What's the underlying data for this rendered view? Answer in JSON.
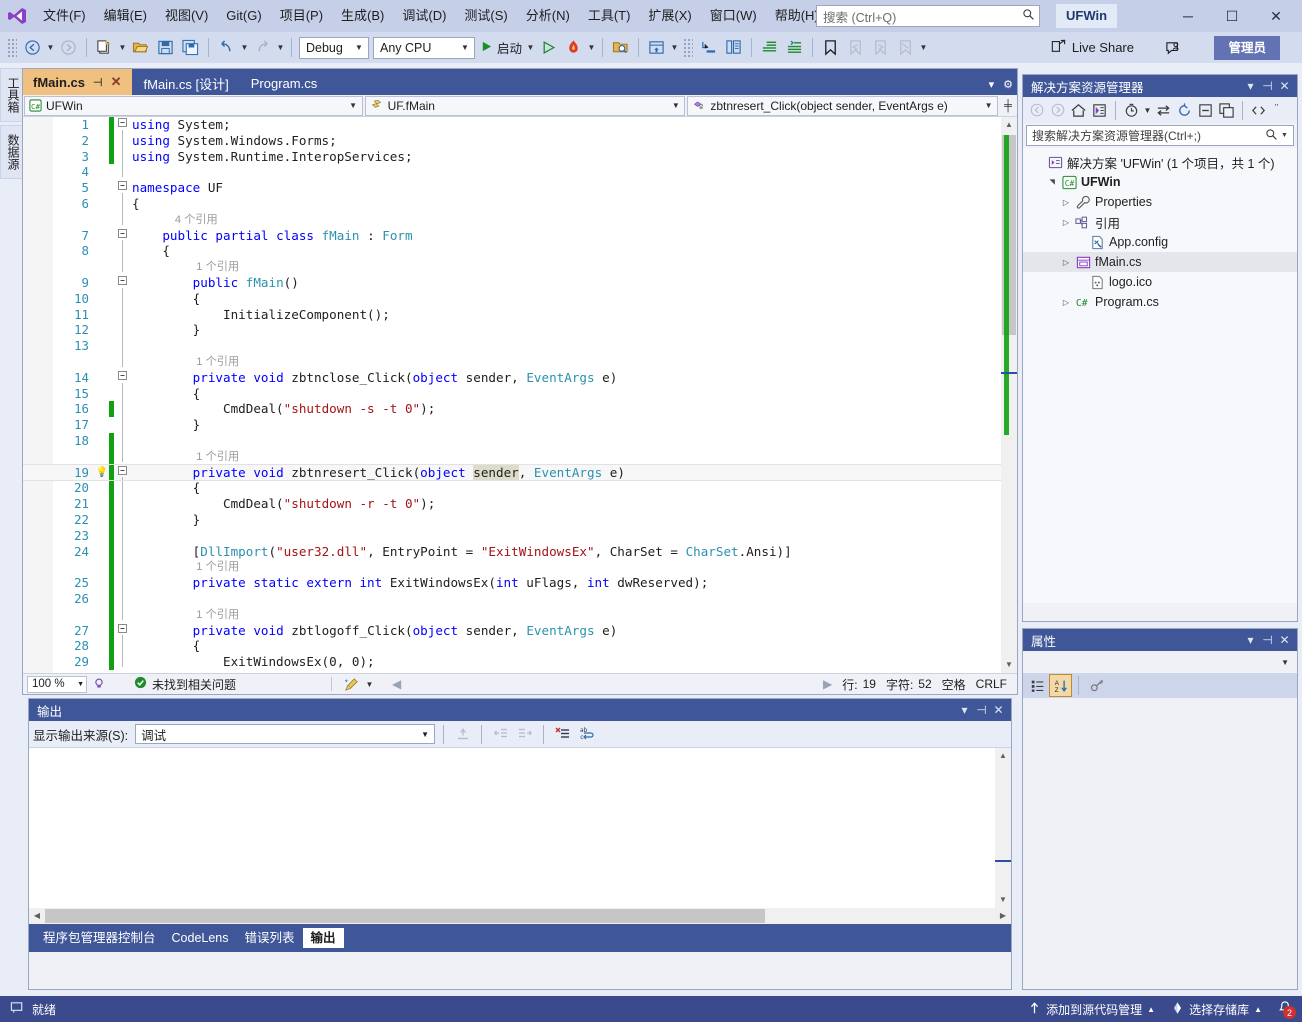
{
  "titlebar": {
    "logo_icon": "visual-studio-logo",
    "menu": [
      {
        "label": "文件(F)"
      },
      {
        "label": "编辑(E)"
      },
      {
        "label": "视图(V)"
      },
      {
        "label": "Git(G)"
      },
      {
        "label": "项目(P)"
      },
      {
        "label": "生成(B)"
      },
      {
        "label": "调试(D)"
      },
      {
        "label": "测试(S)"
      },
      {
        "label": "分析(N)"
      },
      {
        "label": "工具(T)"
      },
      {
        "label": "扩展(X)"
      },
      {
        "label": "窗口(W)"
      },
      {
        "label": "帮助(H)"
      }
    ],
    "search_placeholder": "搜索",
    "search_hint": " (Ctrl+Q)",
    "search_icon": "search-icon",
    "app_name": "UFWin",
    "minimize": "─",
    "maximize": "☐",
    "close": "✕"
  },
  "toolbar": {
    "back_icon": "navigate-back-icon",
    "forward_icon": "navigate-forward-icon",
    "new_project_icon": "new-project-icon",
    "open_icon": "open-file-icon",
    "save_icon": "save-icon",
    "save_all_icon": "save-all-icon",
    "undo_icon": "undo-icon",
    "redo_icon": "redo-icon",
    "configuration": "Debug",
    "platform": "Any CPU",
    "start_label": "启动",
    "start_icon": "run-start-icon",
    "start_no_debug_icon": "run-without-debug-icon",
    "hotreload_icon": "hot-reload-icon",
    "find_in_files_icon": "find-in-files-icon",
    "solution_explorer_icon": "solution-explorer-icon",
    "step_icon": "step-into-icon",
    "compare_icon": "compare-icon",
    "indent_icon": "indent-icon",
    "outdent_icon": "outdent-icon",
    "bookmark_icon": "bookmark-icon",
    "bookmark_prev_icon": "bookmark-prev-icon",
    "bookmark_next_icon": "bookmark-next-icon",
    "bookmark_clear_icon": "bookmark-clear-icon",
    "live_share": "Live Share",
    "live_share_icon": "live-share-icon",
    "feedback_icon": "send-feedback-icon",
    "admin_label": "管理员"
  },
  "left_tabs": [
    {
      "label": "工具箱"
    },
    {
      "label": "数据源"
    }
  ],
  "editor": {
    "tabs": [
      {
        "label": "fMain.cs",
        "active": true,
        "pin_icon": "pin-icon",
        "close_icon": "close-icon"
      },
      {
        "label": "fMain.cs [设计]",
        "active": false
      },
      {
        "label": "Program.cs",
        "active": false
      }
    ],
    "nav_project": "UFWin",
    "nav_project_icon": "csharp-project-icon",
    "nav_type": "UF.fMain",
    "nav_type_icon": "class-icon",
    "nav_member": "zbtnresert_Click(object sender, EventArgs e)",
    "nav_member_icon": "private-method-icon",
    "split_icon": "split-editor-icon",
    "tab_menu_icon": "tab-list-icon",
    "tab_settings_icon": "settings-gear-icon",
    "status": {
      "zoom": "100 %",
      "intellicode_icon": "intellicode-icon",
      "issues_icon": "check-circle-icon",
      "issues": "未找到相关问题",
      "cleanup_icon": "code-cleanup-icon",
      "prev_icon": "prev-arrow-icon",
      "next_icon": "next-arrow-icon",
      "line_label": "行:",
      "line": "19",
      "char_label": "字符:",
      "char": "52",
      "spaces": "空格",
      "eol": "CRLF"
    },
    "lines": [
      {
        "n": "1",
        "fold": "minus",
        "change": "green",
        "indent": 0,
        "tokens": [
          {
            "t": "using ",
            "c": "kw"
          },
          {
            "t": "System;",
            "c": "plain"
          }
        ]
      },
      {
        "n": "2",
        "fold": "",
        "change": "green",
        "indent": 1,
        "tokens": [
          {
            "t": "using ",
            "c": "kw"
          },
          {
            "t": "System.Windows.Forms;",
            "c": "plain"
          }
        ]
      },
      {
        "n": "3",
        "fold": "",
        "change": "green",
        "indent": 1,
        "tokens": [
          {
            "t": "using ",
            "c": "kw"
          },
          {
            "t": "System.Runtime.InteropServices;",
            "c": "plain"
          }
        ]
      },
      {
        "n": "4",
        "fold": "",
        "change": "",
        "indent": 0,
        "tokens": []
      },
      {
        "n": "5",
        "fold": "minus",
        "change": "",
        "indent": 0,
        "tokens": [
          {
            "t": "namespace ",
            "c": "kw"
          },
          {
            "t": "UF",
            "c": "plain"
          }
        ]
      },
      {
        "n": "6",
        "fold": "",
        "change": "",
        "indent": 1,
        "tokens": [
          {
            "t": "{",
            "c": "plain"
          }
        ]
      },
      {
        "n": "",
        "fold": "",
        "change": "",
        "indent": 0,
        "ref": "4 个引用",
        "ref_indent": 4
      },
      {
        "n": "7",
        "fold": "minus",
        "change": "",
        "indent": 0,
        "bookmark": true,
        "tokens": [
          {
            "t": "    ",
            "c": "plain"
          },
          {
            "t": "public partial class ",
            "c": "kw"
          },
          {
            "t": "fMain",
            "c": "ty"
          },
          {
            "t": " : ",
            "c": "plain"
          },
          {
            "t": "Form",
            "c": "ty"
          }
        ]
      },
      {
        "n": "8",
        "fold": "",
        "change": "",
        "indent": 0,
        "tokens": [
          {
            "t": "    {",
            "c": "plain"
          }
        ]
      },
      {
        "n": "",
        "fold": "",
        "change": "",
        "indent": 0,
        "ref": "1 个引用",
        "ref_indent": 6
      },
      {
        "n": "9",
        "fold": "minus",
        "change": "",
        "indent": 0,
        "tokens": [
          {
            "t": "        ",
            "c": "plain"
          },
          {
            "t": "public ",
            "c": "kw"
          },
          {
            "t": "fMain",
            "c": "ty"
          },
          {
            "t": "()",
            "c": "plain"
          }
        ]
      },
      {
        "n": "10",
        "fold": "",
        "change": "",
        "indent": 0,
        "tokens": [
          {
            "t": "        {",
            "c": "plain"
          }
        ]
      },
      {
        "n": "11",
        "fold": "",
        "change": "",
        "indent": 0,
        "tokens": [
          {
            "t": "            InitializeComponent();",
            "c": "plain"
          }
        ]
      },
      {
        "n": "12",
        "fold": "",
        "change": "",
        "indent": 0,
        "tokens": [
          {
            "t": "        }",
            "c": "plain"
          }
        ]
      },
      {
        "n": "13",
        "fold": "",
        "change": "",
        "indent": 0,
        "tokens": []
      },
      {
        "n": "",
        "fold": "",
        "change": "",
        "indent": 0,
        "ref": "1 个引用",
        "ref_indent": 6
      },
      {
        "n": "14",
        "fold": "minus",
        "change": "",
        "indent": 0,
        "tokens": [
          {
            "t": "        ",
            "c": "plain"
          },
          {
            "t": "private void ",
            "c": "kw"
          },
          {
            "t": "zbtnclose_Click(",
            "c": "plain"
          },
          {
            "t": "object",
            "c": "kw"
          },
          {
            "t": " sender, ",
            "c": "plain"
          },
          {
            "t": "EventArgs",
            "c": "ty"
          },
          {
            "t": " e)",
            "c": "plain"
          }
        ]
      },
      {
        "n": "15",
        "fold": "",
        "change": "",
        "indent": 0,
        "tokens": [
          {
            "t": "        {",
            "c": "plain"
          }
        ]
      },
      {
        "n": "16",
        "fold": "",
        "change": "green",
        "indent": 0,
        "tokens": [
          {
            "t": "            CmdDeal(",
            "c": "plain"
          },
          {
            "t": "\"shutdown -s -t 0\"",
            "c": "str"
          },
          {
            "t": ");",
            "c": "plain"
          }
        ]
      },
      {
        "n": "17",
        "fold": "",
        "change": "",
        "indent": 0,
        "tokens": [
          {
            "t": "        }",
            "c": "plain"
          }
        ]
      },
      {
        "n": "18",
        "fold": "",
        "change": "green",
        "indent": 0,
        "tokens": []
      },
      {
        "n": "",
        "fold": "",
        "change": "green",
        "indent": 0,
        "ref": "1 个引用",
        "ref_indent": 6
      },
      {
        "n": "19",
        "fold": "minus",
        "change": "green",
        "indent": 0,
        "current": true,
        "bulb": true,
        "tokens": [
          {
            "t": "        ",
            "c": "plain"
          },
          {
            "t": "private void ",
            "c": "kw"
          },
          {
            "t": "zbtnresert_Click(",
            "c": "plain"
          },
          {
            "t": "object",
            "c": "kw"
          },
          {
            "t": " ",
            "c": "plain"
          },
          {
            "t": "sender",
            "c": "sel"
          },
          {
            "t": ", ",
            "c": "plain"
          },
          {
            "t": "EventArgs",
            "c": "ty"
          },
          {
            "t": " e)",
            "c": "plain"
          }
        ]
      },
      {
        "n": "20",
        "fold": "",
        "change": "green",
        "indent": 0,
        "tokens": [
          {
            "t": "        {",
            "c": "plain"
          }
        ]
      },
      {
        "n": "21",
        "fold": "",
        "change": "green",
        "indent": 0,
        "tokens": [
          {
            "t": "            CmdDeal(",
            "c": "plain"
          },
          {
            "t": "\"shutdown -r -t 0\"",
            "c": "str"
          },
          {
            "t": ");",
            "c": "plain"
          }
        ]
      },
      {
        "n": "22",
        "fold": "",
        "change": "green",
        "indent": 0,
        "tokens": [
          {
            "t": "        }",
            "c": "plain"
          }
        ]
      },
      {
        "n": "23",
        "fold": "",
        "change": "green",
        "indent": 0,
        "tokens": []
      },
      {
        "n": "24",
        "fold": "",
        "change": "green",
        "indent": 0,
        "tokens": [
          {
            "t": "        [",
            "c": "plain"
          },
          {
            "t": "DllImport",
            "c": "ty"
          },
          {
            "t": "(",
            "c": "plain"
          },
          {
            "t": "\"user32.dll\"",
            "c": "str"
          },
          {
            "t": ", EntryPoint = ",
            "c": "plain"
          },
          {
            "t": "\"ExitWindowsEx\"",
            "c": "str"
          },
          {
            "t": ", CharSet = ",
            "c": "plain"
          },
          {
            "t": "CharSet",
            "c": "ty"
          },
          {
            "t": ".Ansi)]",
            "c": "plain"
          }
        ]
      },
      {
        "n": "",
        "fold": "",
        "change": "green",
        "indent": 0,
        "ref": "1 个引用",
        "ref_indent": 6
      },
      {
        "n": "25",
        "fold": "",
        "change": "green",
        "indent": 0,
        "tokens": [
          {
            "t": "        ",
            "c": "plain"
          },
          {
            "t": "private static extern int ",
            "c": "kw"
          },
          {
            "t": "ExitWindowsEx(",
            "c": "plain"
          },
          {
            "t": "int",
            "c": "kw"
          },
          {
            "t": " uFlags, ",
            "c": "plain"
          },
          {
            "t": "int",
            "c": "kw"
          },
          {
            "t": " dwReserved);",
            "c": "plain"
          }
        ]
      },
      {
        "n": "26",
        "fold": "",
        "change": "green",
        "indent": 0,
        "tokens": []
      },
      {
        "n": "",
        "fold": "",
        "change": "green",
        "indent": 0,
        "ref": "1 个引用",
        "ref_indent": 6
      },
      {
        "n": "27",
        "fold": "minus",
        "change": "green",
        "indent": 0,
        "tokens": [
          {
            "t": "        ",
            "c": "plain"
          },
          {
            "t": "private void ",
            "c": "kw"
          },
          {
            "t": "zbtlogoff_Click(",
            "c": "plain"
          },
          {
            "t": "object",
            "c": "kw"
          },
          {
            "t": " sender, ",
            "c": "plain"
          },
          {
            "t": "EventArgs",
            "c": "ty"
          },
          {
            "t": " e)",
            "c": "plain"
          }
        ]
      },
      {
        "n": "28",
        "fold": "",
        "change": "green",
        "indent": 0,
        "tokens": [
          {
            "t": "        {",
            "c": "plain"
          }
        ]
      },
      {
        "n": "29",
        "fold": "",
        "change": "green",
        "indent": 0,
        "tokens": [
          {
            "t": "            ExitWindowsEx(0, 0);",
            "c": "plain"
          }
        ]
      }
    ]
  },
  "output_panel": {
    "title": "输出",
    "dropdown_icon": "chevron-down-icon",
    "pin_icon": "pin-icon",
    "close_icon": "close-icon",
    "source_label": "显示输出来源(S):",
    "source_value": "调试",
    "btn_goto_icon": "go-to-message-icon",
    "btn_prev_icon": "prev-message-icon",
    "btn_next_icon": "next-message-icon",
    "btn_clear_icon": "clear-all-icon",
    "btn_wrap_icon": "toggle-word-wrap-icon",
    "body_text": "",
    "tabs": [
      {
        "label": "程序包管理器控制台",
        "active": false
      },
      {
        "label": "CodeLens",
        "active": false
      },
      {
        "label": "错误列表",
        "active": false
      },
      {
        "label": "输出",
        "active": true
      }
    ]
  },
  "solution_explorer": {
    "title": "解决方案资源管理器",
    "dropdown_icon": "chevron-down-icon",
    "pin_icon": "pin-icon",
    "close_icon": "close-icon",
    "toolbar": {
      "back_icon": "nav-back-icon",
      "forward_icon": "nav-forward-icon",
      "home_icon": "home-icon",
      "switch_views_icon": "switch-views-icon",
      "pending_changes_icon": "pending-changes-icon",
      "sync_icon": "sync-with-active-document-icon",
      "refresh_icon": "refresh-icon",
      "collapse_icon": "collapse-all-icon",
      "show_all_icon": "show-all-files-icon",
      "view_code_icon": "view-code-icon",
      "properties_icon": "properties-icon"
    },
    "search_placeholder": "搜索解决方案资源管理器(Ctrl+;)",
    "search_icon": "search-icon",
    "search_dropdown_icon": "chevron-down-icon",
    "tree": [
      {
        "label": "解决方案 'UFWin' (1 个项目，共 1 个)",
        "icon": "solution-icon",
        "arrow": "",
        "depth": 0,
        "selected": false
      },
      {
        "label": "UFWin",
        "icon": "csharp-project-icon",
        "arrow": "expanded",
        "depth": 1,
        "selected": false,
        "bold": true
      },
      {
        "label": "Properties",
        "icon": "properties-wrench-icon",
        "arrow": "collapsed",
        "depth": 2,
        "selected": false
      },
      {
        "label": "引用",
        "icon": "references-icon",
        "arrow": "collapsed",
        "depth": 2,
        "selected": false
      },
      {
        "label": "App.config",
        "icon": "config-file-icon",
        "arrow": "",
        "depth": 3,
        "selected": false
      },
      {
        "label": "fMain.cs",
        "icon": "form-icon",
        "arrow": "collapsed",
        "depth": 2,
        "selected": true
      },
      {
        "label": "logo.ico",
        "icon": "icon-file-icon",
        "arrow": "",
        "depth": 3,
        "selected": false
      },
      {
        "label": "Program.cs",
        "icon": "csharp-file-icon",
        "arrow": "collapsed",
        "depth": 2,
        "selected": false
      }
    ]
  },
  "properties_panel": {
    "title": "属性",
    "dropdown_icon": "chevron-down-icon",
    "pin_icon": "pin-icon",
    "close_icon": "close-icon",
    "object_dropdown_icon": "chevron-down-icon",
    "categorized_icon": "categorized-view-icon",
    "alphabetical_icon": "alphabetical-sort-icon",
    "properties_icon": "properties-key-icon"
  },
  "statusbar": {
    "ready_icon": "ready-icon",
    "ready": "就绪",
    "source_control_icon": "add-to-source-control-icon",
    "source_control": "添加到源代码管理",
    "repository_icon": "select-repository-icon",
    "repository": "选择存储库",
    "notifications_icon": "bell-icon",
    "notifications_count": "2"
  },
  "colors": {
    "title_bg": "#c5cfe8",
    "toolbar_bg": "#d3dbee",
    "panel_header": "#3f5699",
    "statusbar": "#3a4a8c",
    "active_tab": "#f0c080",
    "accent": "#2b91af",
    "keyword": "#0000ff",
    "string": "#a31515",
    "change_marker": "#11a011"
  }
}
